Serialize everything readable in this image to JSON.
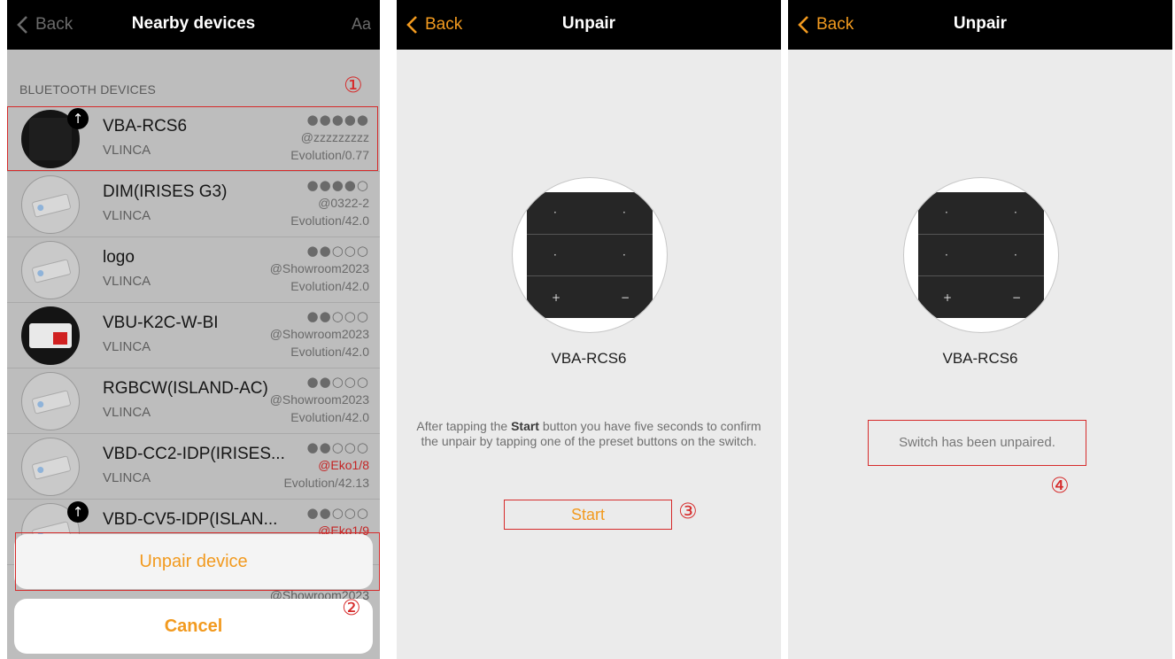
{
  "panel1": {
    "back": "Back",
    "title": "Nearby devices",
    "aa": "Aa",
    "section": "BLUETOOTH DEVICES",
    "marker": "①",
    "devices": [
      {
        "name": "VBA-RCS6",
        "vendor": "VLINCA",
        "signal": "●●●●●",
        "network": "@zzzzzzzzz",
        "firmware": "Evolution/0.77"
      },
      {
        "name": "DIM(IRISES G3)",
        "vendor": "VLINCA",
        "signal": "●●●●○",
        "network": "@0322-2",
        "firmware": "Evolution/42.0"
      },
      {
        "name": "logo",
        "vendor": "VLINCA",
        "signal": "●●○○○",
        "network": "@Showroom2023",
        "firmware": "Evolution/42.0"
      },
      {
        "name": "VBU-K2C-W-BI",
        "vendor": "VLINCA",
        "signal": "●●○○○",
        "network": "@Showroom2023",
        "firmware": "Evolution/42.0"
      },
      {
        "name": "RGBCW(ISLAND-AC)",
        "vendor": "VLINCA",
        "signal": "●●○○○",
        "network": "@Showroom2023",
        "firmware": "Evolution/42.0"
      },
      {
        "name": "VBD-CC2-IDP(IRISES...",
        "vendor": "VLINCA",
        "signal": "●●○○○",
        "network": "@Eko1/8",
        "firmware": "Evolution/42.13"
      },
      {
        "name": "VBD-CV5-IDP(ISLAN...",
        "vendor": "",
        "signal": "●●○○○",
        "network": "@Eko1/9",
        "firmware": ""
      }
    ],
    "under_sheet_net": "@Showroom2023",
    "unpair": "Unpair device",
    "cancel": "Cancel",
    "marker2": "②",
    "upload_icon": "↑"
  },
  "panel2": {
    "back": "Back",
    "title": "Unpair",
    "device": "VBA-RCS6",
    "info_pre": "After tapping the ",
    "info_bold": "Start",
    "info_post": " button you have five seconds to confirm the unpair by tapping one of the preset buttons on the switch.",
    "start": "Start",
    "marker": "③",
    "keys": [
      "·",
      "·",
      "·",
      "·",
      "+",
      "−"
    ]
  },
  "panel3": {
    "back": "Back",
    "title": "Unpair",
    "device": "VBA-RCS6",
    "status": "Switch has been unpaired.",
    "marker": "④",
    "keys": [
      "·",
      "·",
      "·",
      "·",
      "+",
      "−"
    ]
  },
  "colors": {
    "accent": "#f29a1f",
    "highlight": "#d62b2b",
    "navbar": "#000000"
  }
}
